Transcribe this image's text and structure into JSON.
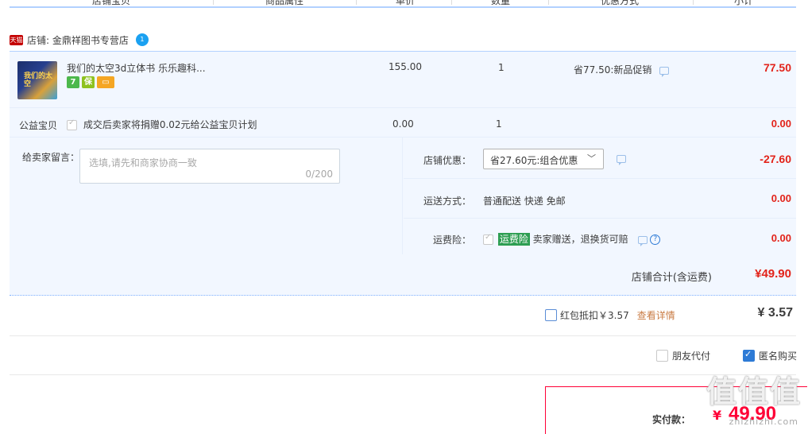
{
  "table_header": {
    "columns": [
      "店铺宝贝",
      "商品属性",
      "单价",
      "数量",
      "优惠方式",
      "小计"
    ]
  },
  "shop": {
    "badge": "天猫",
    "label": "店铺: 金鼎祥图书专营店",
    "chat_badge": "1"
  },
  "item": {
    "thumb_text": "我们的太空",
    "title": "我们的太空3d立体书 乐乐趣科...",
    "price": "155.00",
    "quantity": "1",
    "discount": "省77.50:新品促销",
    "subtotal": "77.50",
    "service_icons": [
      {
        "name": "7-day-return-icon",
        "label": "7",
        "color": "#4cb84c"
      },
      {
        "name": "guarantee-icon",
        "label": "保",
        "color": "#8ec21f"
      },
      {
        "name": "card-payment-icon",
        "label": "▭",
        "color": "#f5a623"
      }
    ]
  },
  "charity": {
    "label": "公益宝贝",
    "text": "成交后卖家将捐赠0.02元给公益宝贝计划",
    "price": "0.00",
    "quantity": "1",
    "subtotal": "0.00"
  },
  "message": {
    "label": "给卖家留言：",
    "placeholder": "选填,请先和商家协商一致",
    "counter": "0/200"
  },
  "shop_discount": {
    "label": "店铺优惠：",
    "selected": "省27.60元:组合优惠",
    "amount": "-27.60"
  },
  "shipping": {
    "label": "运送方式：",
    "value": "普通配送 快递 免邮",
    "amount": "0.00"
  },
  "insurance": {
    "label": "运费险：",
    "tag": "运费险",
    "text": "卖家赠送，退换货可赔",
    "amount": "0.00"
  },
  "shop_total": {
    "label": "店铺合计(含运费)",
    "amount": "¥49.90"
  },
  "red_packet": {
    "label": "红包抵扣￥3.57",
    "link": "查看详情",
    "amount": "¥ 3.57"
  },
  "options": {
    "friend_pay": "朋友代付",
    "anonymous": "匿名购买"
  },
  "pay": {
    "label": "实付款：",
    "currency": "¥",
    "amount": "49.90"
  },
  "watermark": {
    "main": "值值值",
    "sub": "zhizhizhi.com"
  }
}
